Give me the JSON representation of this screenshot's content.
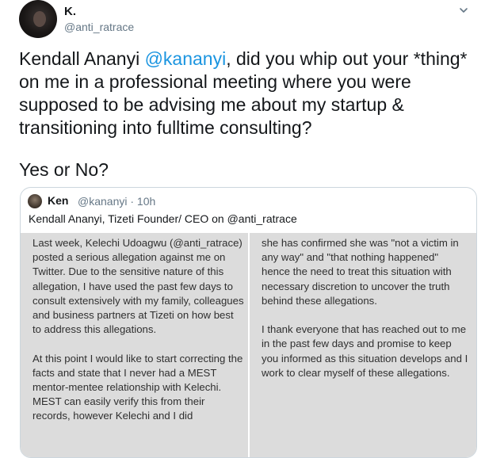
{
  "author": {
    "name": "K.",
    "handle": "@anti_ratrace"
  },
  "tweet": {
    "name_prefix": "Kendall Ananyi ",
    "mention": "@kananyi",
    "body_rest": ", did you whip out your *thing* on me in a professional meeting where you were supposed to be advising me about my startup & transitioning into fulltime consulting?",
    "question": "Yes or No?"
  },
  "quoted": {
    "name": "Ken",
    "meta": "@kananyi · 10h",
    "text": "Kendall Ananyi, Tizeti Founder/ CEO on @anti_ratrace",
    "image_left": [
      "Last week, Kelechi Udoagwu (@anti_ratrace) posted a serious allegation against me on Twitter.  Due to the sensitive nature of this allegation, I have used the past few days to consult extensively with my family, colleagues and business partners at Tizeti on how best to address this allegations.",
      "At this point I would like to start correcting the facts and state that I never had a MEST mentor-mentee relationship with Kelechi. MEST can easily verify this from their records, however Kelechi and I did"
    ],
    "image_right": [
      "she has confirmed she was \"not a victim in any way\" and \"that nothing happened\" hence the need to treat this situation with necessary discretion to uncover the truth behind these allegations.",
      "I thank everyone that has reached out to me in the past few days and promise to keep you informed as this situation develops and I work to clear myself of these allegations."
    ]
  },
  "icons": {
    "menu": "chevron-down-icon"
  }
}
